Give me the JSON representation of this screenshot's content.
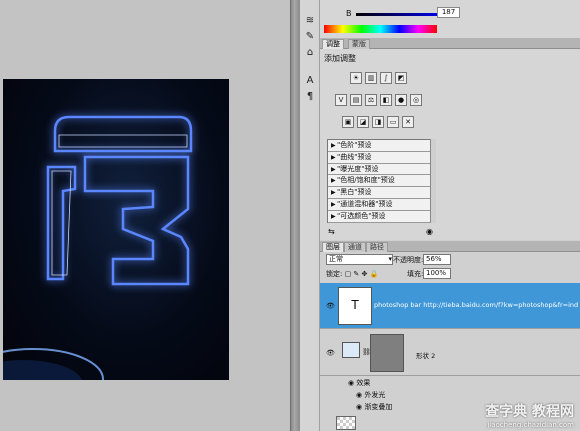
{
  "color_panel": {
    "channel_label": "B",
    "channel_value": "187"
  },
  "adjustments": {
    "tabs": [
      "调整",
      "蒙版"
    ],
    "title": "添加调整",
    "presets": [
      "\"色阶\"预设",
      "\"曲线\"预设",
      "\"曝光度\"预设",
      "\"色相/饱和度\"预设",
      "\"黑白\"预设",
      "\"通道混和器\"预设",
      "\"可选颜色\"预设"
    ]
  },
  "layers": {
    "tabs": [
      "图层",
      "通道",
      "路径"
    ],
    "blend_mode": "正常",
    "opacity_label": "不透明度:",
    "opacity_value": "56%",
    "lock_label": "锁定:",
    "fill_label": "填充:",
    "fill_value": "100%",
    "text_layer_name": "photoshop bar http://tieba.baidu.com/f?kw=photoshop&fr=index&ie",
    "text_layer_thumb": "T",
    "shape_layer_name": "形状 2",
    "effects_label": "效果",
    "effect_outer_glow": "外发光",
    "effect_gradient_overlay": "渐变叠加"
  },
  "watermark": {
    "title": "查字典 教程网",
    "url": "jiaocheng.chazidian.com"
  },
  "colors": {
    "selection": "#3f97d8",
    "glow": "#3a6fff"
  }
}
